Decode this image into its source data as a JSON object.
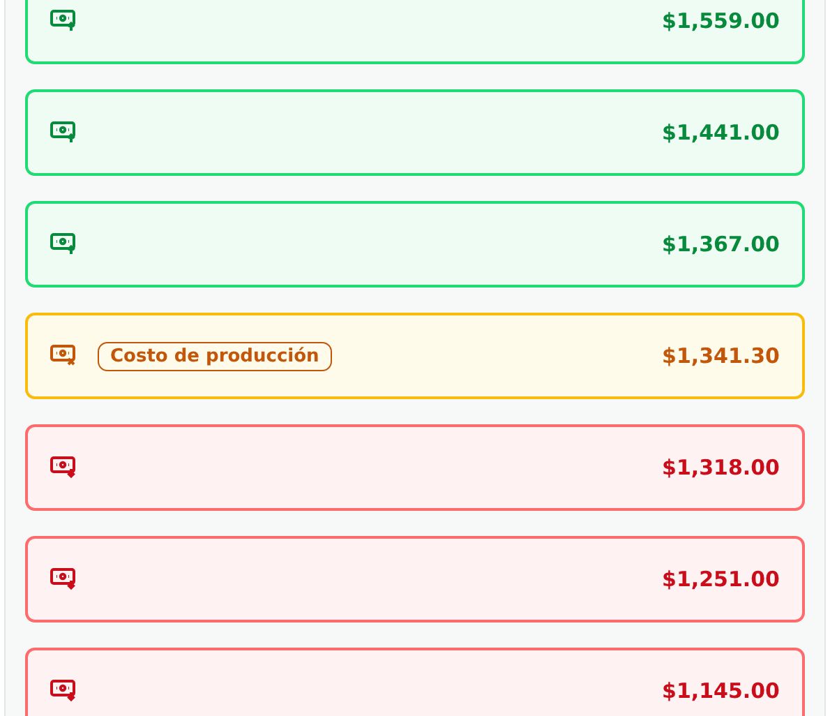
{
  "entries": [
    {
      "kind": "gain",
      "amount": "$1,559.00"
    },
    {
      "kind": "gain",
      "amount": "$1,441.00"
    },
    {
      "kind": "gain",
      "amount": "$1,367.00"
    },
    {
      "kind": "cost",
      "badge": "Costo de producción",
      "amount": "$1,341.30"
    },
    {
      "kind": "loss",
      "amount": "$1,318.00"
    },
    {
      "kind": "loss",
      "amount": "$1,251.00"
    },
    {
      "kind": "loss",
      "amount": "$1,145.00"
    }
  ]
}
